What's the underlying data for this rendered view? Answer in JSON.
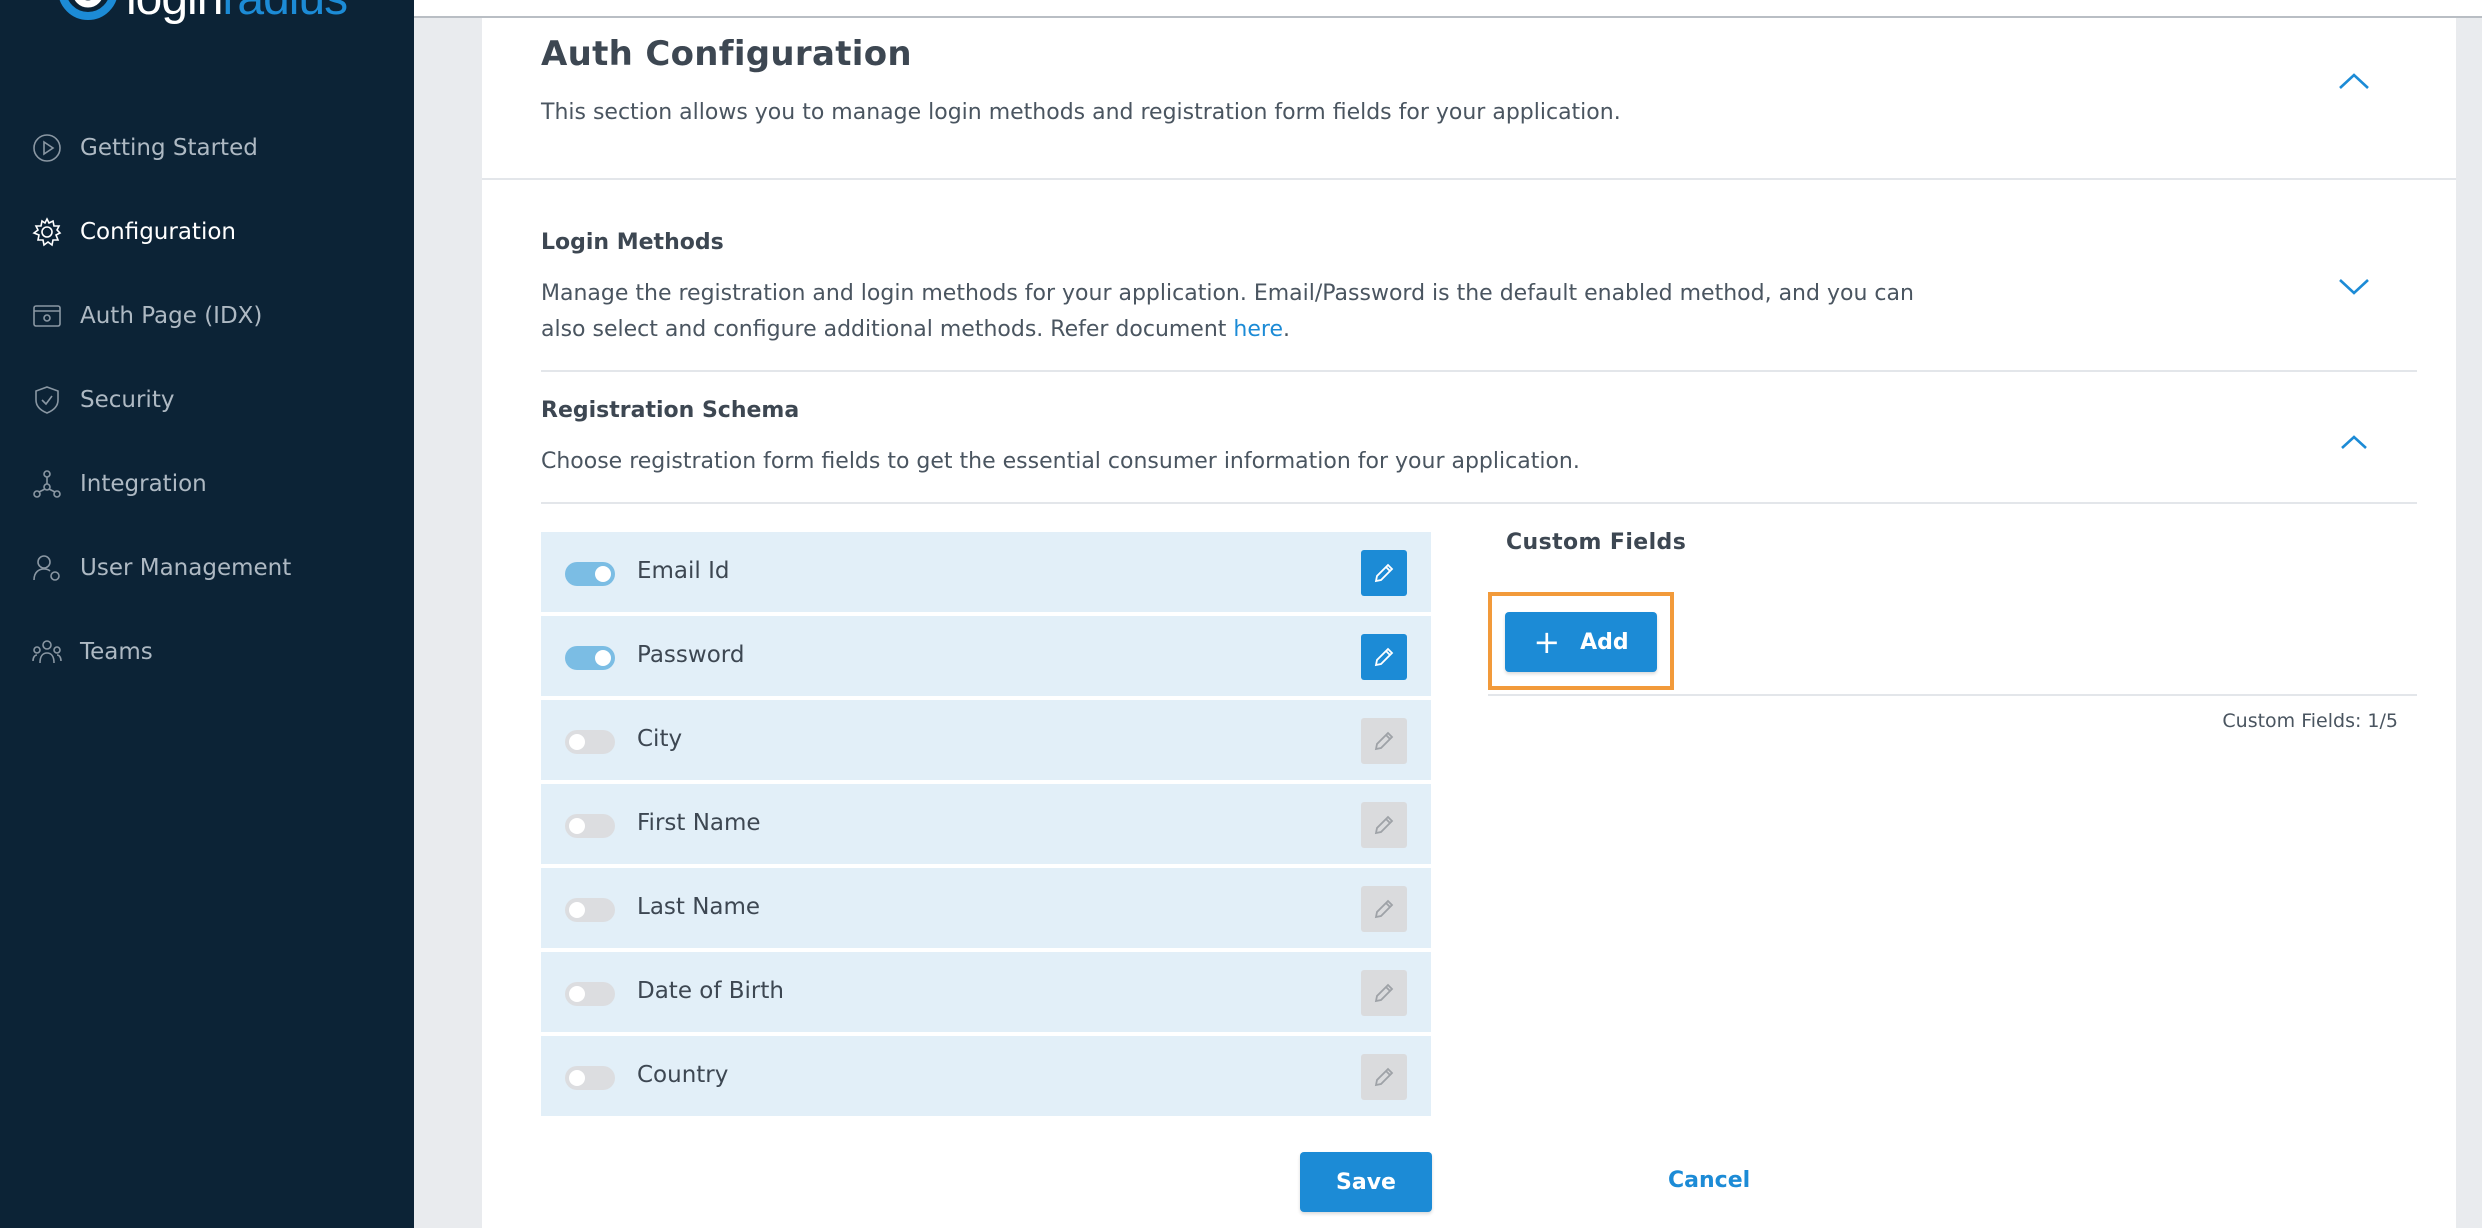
{
  "brand": {
    "logo_text_main": "login",
    "logo_text_accent": "radius"
  },
  "sidebar": {
    "items": [
      {
        "label": "Getting Started",
        "icon": "play-circle-icon",
        "active": false
      },
      {
        "label": "Configuration",
        "icon": "gear-icon",
        "active": true
      },
      {
        "label": "Auth Page (IDX)",
        "icon": "auth-page-icon",
        "active": false
      },
      {
        "label": "Security",
        "icon": "shield-icon",
        "active": false
      },
      {
        "label": "Integration",
        "icon": "integration-icon",
        "active": false
      },
      {
        "label": "User Management",
        "icon": "user-settings-icon",
        "active": false
      },
      {
        "label": "Teams",
        "icon": "teams-icon",
        "active": false
      }
    ]
  },
  "auth": {
    "title": "Auth Configuration",
    "subtitle": "This section allows you to manage login methods and registration form fields for your application."
  },
  "login_methods": {
    "title": "Login Methods",
    "desc": "Manage the registration and login methods for your application. Email/Password is the default enabled method, and you can also select and configure additional methods. Refer document ",
    "link": "here",
    "period": "."
  },
  "registration": {
    "title": "Registration Schema",
    "desc": "Choose registration form fields to get the essential consumer information for your application.",
    "fields": [
      {
        "label": "Email Id",
        "enabled": true
      },
      {
        "label": "Password",
        "enabled": true
      },
      {
        "label": "City",
        "enabled": false
      },
      {
        "label": "First Name",
        "enabled": false
      },
      {
        "label": "Last Name",
        "enabled": false
      },
      {
        "label": "Date of Birth",
        "enabled": false
      },
      {
        "label": "Country",
        "enabled": false
      }
    ]
  },
  "custom_fields": {
    "title": "Custom Fields",
    "add_label": "Add",
    "add_icon": "plus-icon",
    "count": "Custom Fields: 1/5"
  },
  "actions": {
    "cancel": "Cancel",
    "save": "Save"
  },
  "colors": {
    "sidebar_bg": "#0c2336",
    "accent": "#1c8bd6",
    "highlight": "#f29a3a",
    "row_bg": "#e2eff8"
  }
}
